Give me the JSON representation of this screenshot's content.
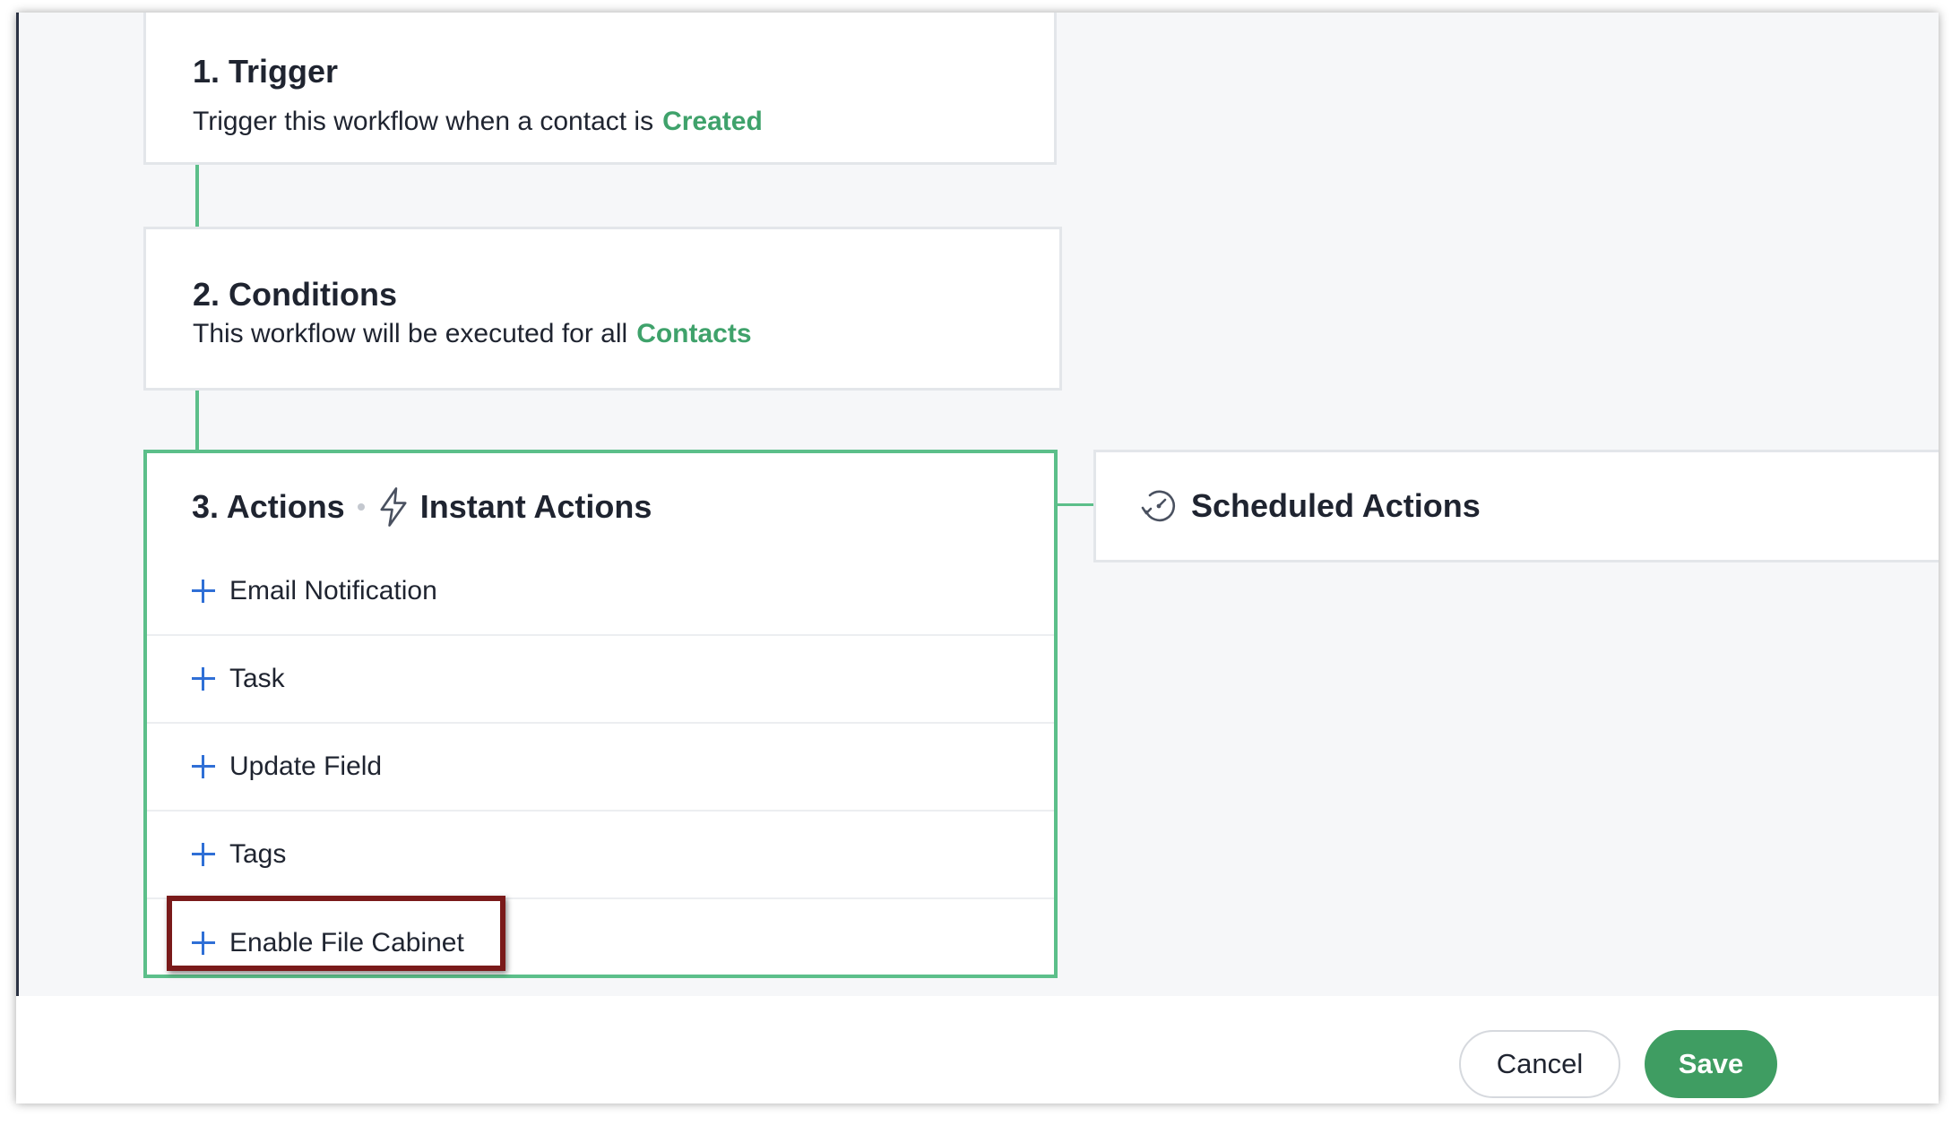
{
  "trigger": {
    "title": "1. Trigger",
    "description": "Trigger this workflow when a contact is",
    "value": "Created"
  },
  "conditions": {
    "title": "2. Conditions",
    "description": "This workflow will be executed for all",
    "value": "Contacts"
  },
  "actions": {
    "title": "3. Actions",
    "instant_label": "Instant Actions",
    "items": [
      {
        "label": "Email Notification"
      },
      {
        "label": "Task"
      },
      {
        "label": "Update Field"
      },
      {
        "label": "Tags"
      },
      {
        "label": "Enable File Cabinet"
      }
    ]
  },
  "scheduled": {
    "title": "Scheduled Actions"
  },
  "footer": {
    "cancel_label": "Cancel",
    "save_label": "Save"
  },
  "colors": {
    "accent_green": "#3fa26b",
    "border_active": "#5cbf8a",
    "plus_blue": "#2f6fd6",
    "save_button": "#3f9d62",
    "highlight": "#7a1a1a"
  },
  "icons": {
    "instant": "lightning-icon",
    "scheduled": "clock-icon",
    "add": "plus-icon"
  }
}
